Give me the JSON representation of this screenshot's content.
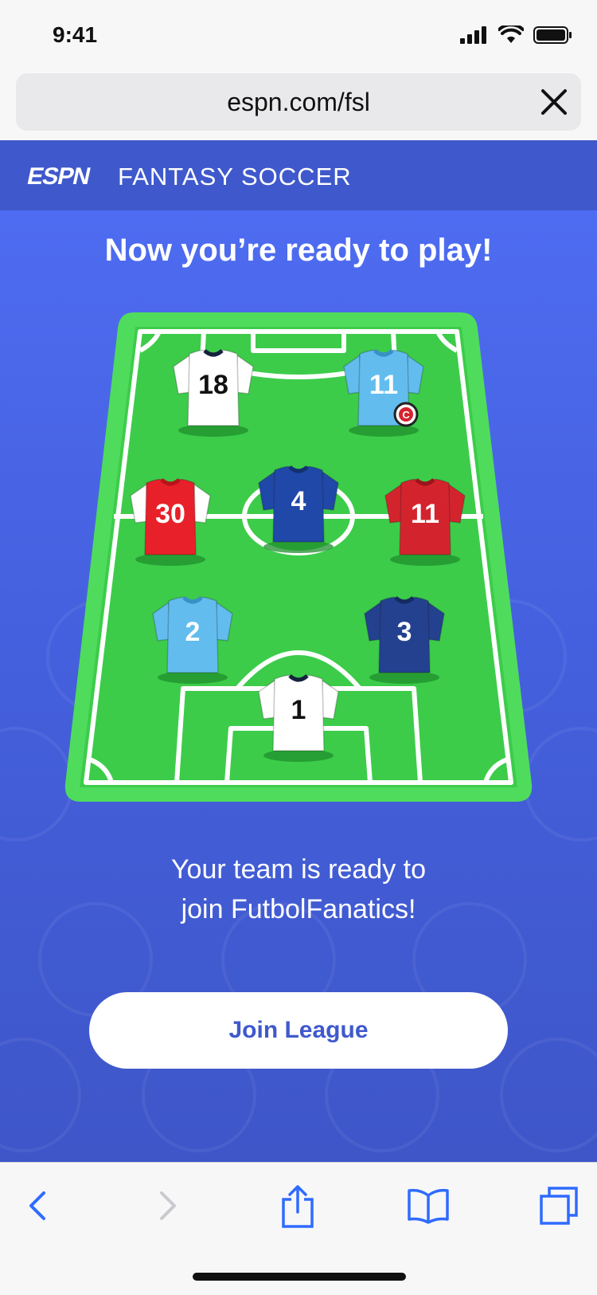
{
  "status_bar": {
    "time": "9:41"
  },
  "browser": {
    "url": "espn.com/fsl"
  },
  "header": {
    "logo": "ESPN",
    "title": "FANTASY SOCCER"
  },
  "main": {
    "headline": "Now you’re ready to play!",
    "message_line1": "Your team is ready to",
    "message_line2": "join FutbolFanatics!",
    "join_button": "Join League"
  },
  "lineup": [
    {
      "number": "18",
      "kit": "white",
      "captain": false
    },
    {
      "number": "11",
      "kit": "sky-blue",
      "captain": true
    },
    {
      "number": "30",
      "kit": "red-white-sleeves",
      "captain": false
    },
    {
      "number": "4",
      "kit": "royal-blue",
      "captain": false
    },
    {
      "number": "11",
      "kit": "red",
      "captain": false
    },
    {
      "number": "2",
      "kit": "sky-blue",
      "captain": false
    },
    {
      "number": "3",
      "kit": "navy",
      "captain": false
    },
    {
      "number": "1",
      "kit": "white",
      "captain": false
    }
  ],
  "captain_badge": "C",
  "colors": {
    "brand_blue": "#3f59cc",
    "pitch_green": "#3fd24f",
    "pitch_border": "#4fdc5c"
  },
  "toolbar": {
    "icons": [
      "back-icon",
      "forward-icon",
      "share-icon",
      "bookmarks-icon",
      "tabs-icon"
    ]
  }
}
